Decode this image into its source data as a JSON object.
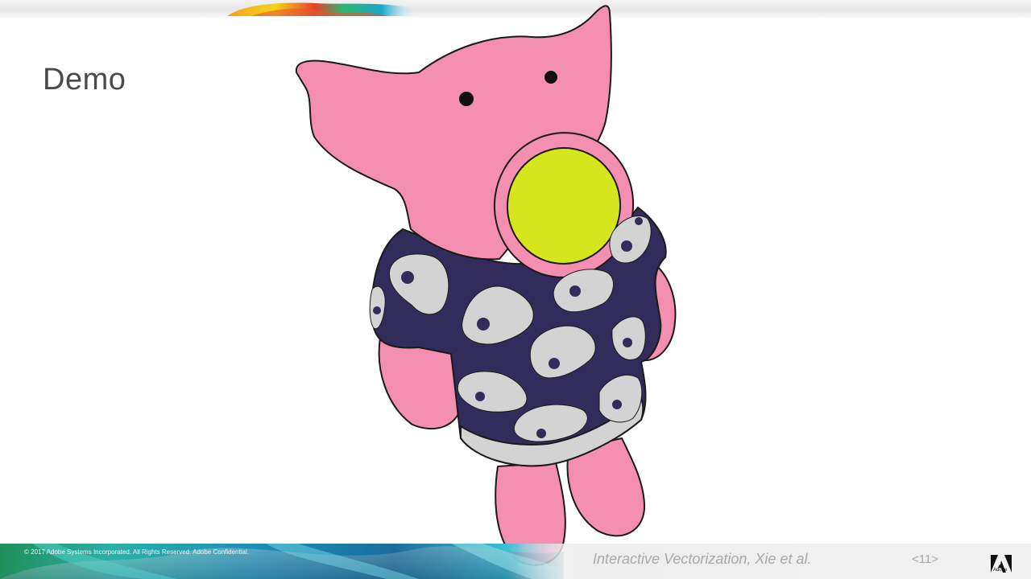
{
  "slide": {
    "title": "Demo"
  },
  "footer": {
    "copyright": "© 2017 Adobe Systems Incorporated.  All Rights Reserved.  Adobe Confidential.",
    "presentation_title": "Interactive Vectorization, Xie et al.",
    "page_number": "<11>",
    "brand_text": "Adobe"
  },
  "colors": {
    "pig_pink": "#f48fb1",
    "shirt_navy": "#312c5c",
    "spot_grey": "#d3d3d3",
    "snout_yellow": "#d6e61d",
    "outline": "#1a1a1a",
    "brand_red": "#000000"
  },
  "icons": {
    "brand": "adobe-logo-icon"
  }
}
